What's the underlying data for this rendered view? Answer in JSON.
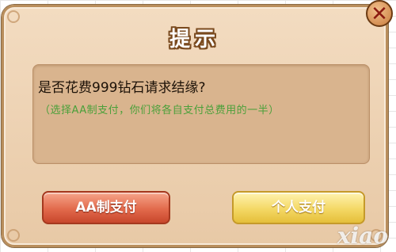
{
  "dialog": {
    "title": "提示",
    "close_icon_glyph": "✕",
    "message": {
      "question": "是否花费999钻石请求结缘?",
      "hint": "（选择AA制支付，你们将各自支付总费用的一半）"
    },
    "buttons": {
      "aa_pay_label": "AA制支付",
      "personal_pay_label": "个人支付"
    }
  },
  "watermark": "xiao",
  "colors": {
    "hint_text": "#4aa03a",
    "aa_button": "#e26a4c",
    "personal_button": "#f4d865",
    "dialog_bg": "#ecd0b0"
  }
}
